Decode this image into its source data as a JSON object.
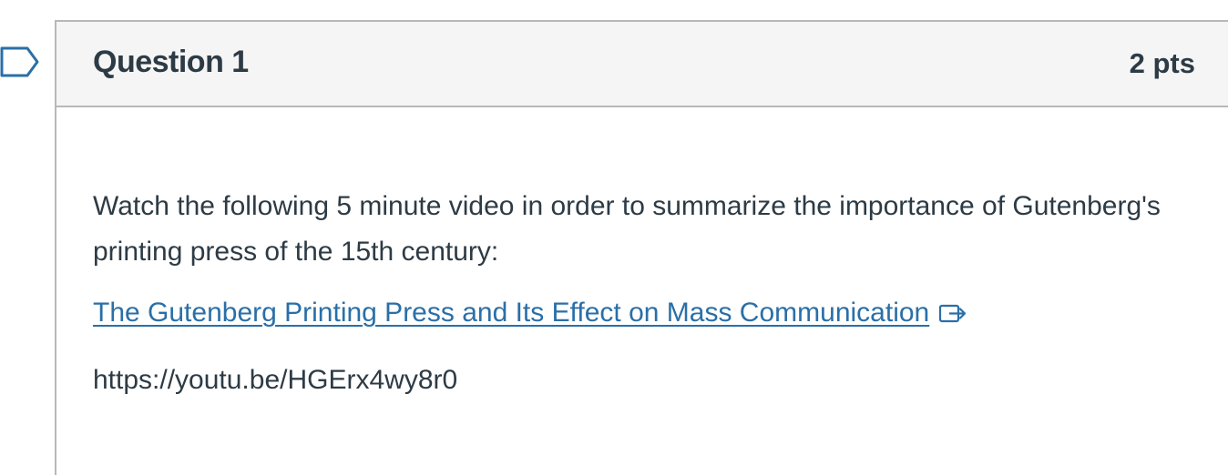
{
  "question": {
    "title": "Question 1",
    "points": "2 pts",
    "prompt": "Watch the following 5 minute video in order to summarize the importance of Gutenberg's printing press of the 15th century:",
    "link_text": "The Gutenberg Printing Press and Its Effect on Mass Communication",
    "url_text": "https://youtu.be/HGErx4wy8r0"
  },
  "icons": {
    "flag": "bookmark-flag-icon",
    "external": "external-link-icon"
  },
  "colors": {
    "link": "#2a6fa8",
    "text": "#2d3b45",
    "header_bg": "#f5f5f5",
    "border": "#b8b8b8"
  }
}
